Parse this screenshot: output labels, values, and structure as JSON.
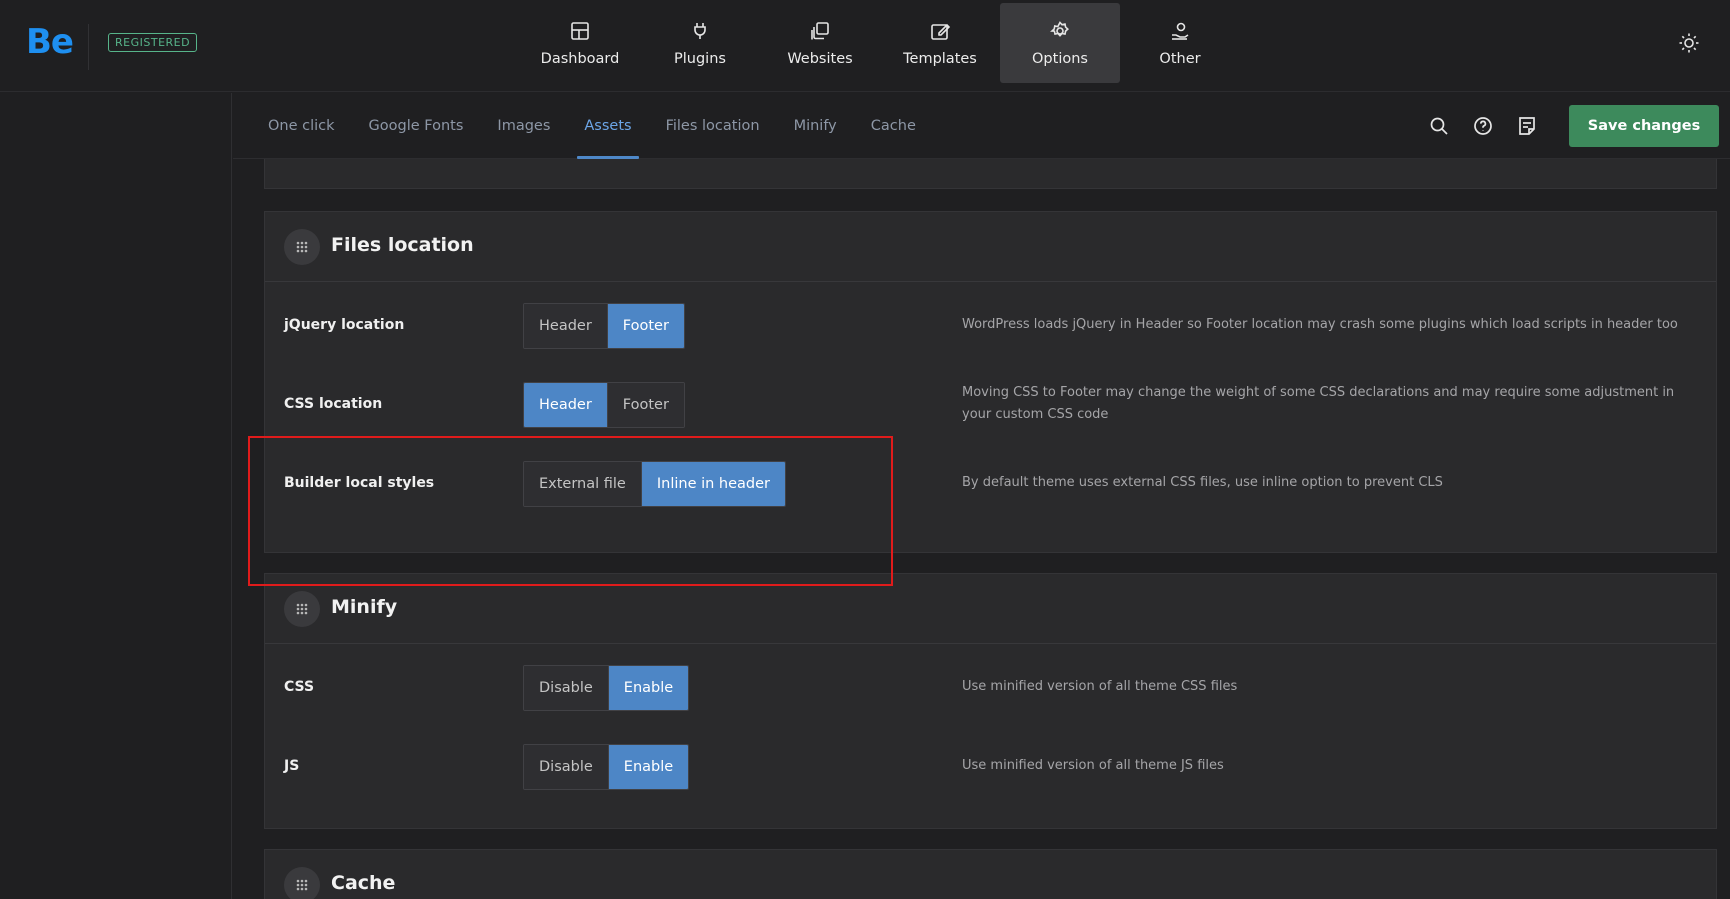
{
  "app": {
    "logo": "Be",
    "badge": "REGISTERED"
  },
  "mainnav": {
    "items": [
      {
        "label": "Dashboard",
        "icon": "dashboard-icon"
      },
      {
        "label": "Plugins",
        "icon": "plug-icon"
      },
      {
        "label": "Websites",
        "icon": "websites-icon"
      },
      {
        "label": "Templates",
        "icon": "templates-icon"
      },
      {
        "label": "Options",
        "icon": "gear-icon",
        "active": true
      },
      {
        "label": "Other",
        "icon": "other-icon"
      }
    ]
  },
  "subnav": {
    "tabs": [
      "One click",
      "Google Fonts",
      "Images",
      "Assets",
      "Files location",
      "Minify",
      "Cache"
    ],
    "active_tab": "Assets",
    "save_label": "Save changes"
  },
  "sections": {
    "files_location": {
      "title": "Files location",
      "rows": [
        {
          "label": "jQuery location",
          "options": [
            "Header",
            "Footer"
          ],
          "selected": "Footer",
          "description": "WordPress loads jQuery in Header so Footer location may crash some plugins which load scripts in header too"
        },
        {
          "label": "CSS location",
          "options": [
            "Header",
            "Footer"
          ],
          "selected": "Header",
          "description": "Moving CSS to Footer may change the weight of some CSS declarations and may require some adjustment in your custom CSS code"
        },
        {
          "label": "Builder local styles",
          "options": [
            "External file",
            "Inline in header"
          ],
          "selected": "Inline in header",
          "description": "By default theme uses external CSS files, use inline option to prevent CLS"
        }
      ]
    },
    "minify": {
      "title": "Minify",
      "rows": [
        {
          "label": "CSS",
          "options": [
            "Disable",
            "Enable"
          ],
          "selected": "Enable",
          "description": "Use minified version of all theme CSS files"
        },
        {
          "label": "JS",
          "options": [
            "Disable",
            "Enable"
          ],
          "selected": "Enable",
          "description": "Use minified version of all theme JS files"
        }
      ]
    },
    "cache": {
      "title": "Cache"
    }
  },
  "colors": {
    "accent": "#4d86c6",
    "save": "#3d8a5c",
    "logo": "#1e8ff0",
    "badge": "#57b48a",
    "highlight": "#e01b1b"
  }
}
